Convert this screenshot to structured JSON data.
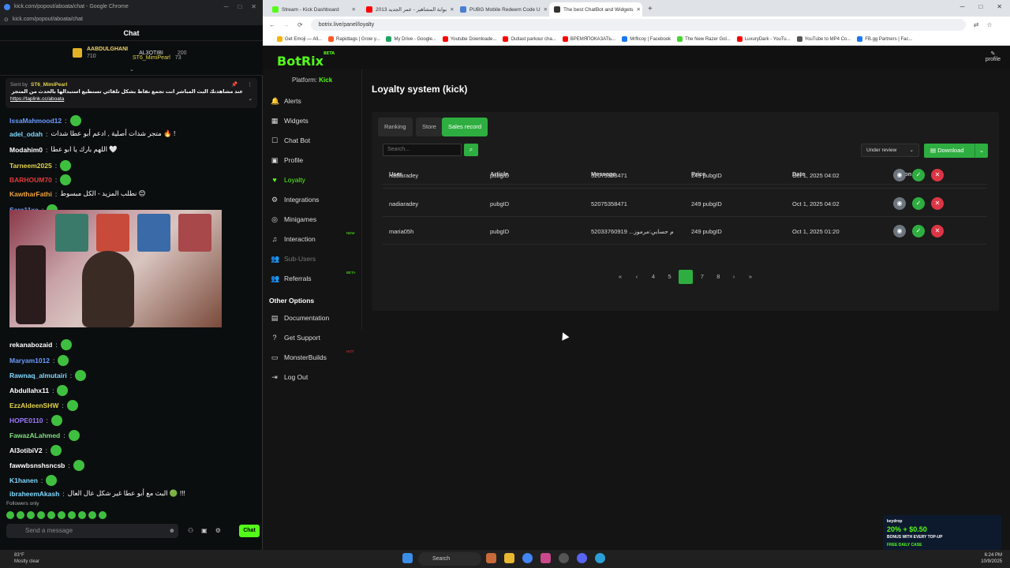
{
  "chat_window": {
    "title": "kick.com/popout/aboata/chat - Google Chrome",
    "url": "kick.com/popout/aboata/chat",
    "header": "Chat",
    "leaderboard": [
      {
        "name": "AABDULGHANI",
        "sub": "710",
        "name2": "AL3OTIBI",
        "sub2": "200"
      },
      {
        "name": "ST6_MimiPearl",
        "sub": "73"
      }
    ],
    "pinned": {
      "sender_prefix": "Sent by",
      "sender": "ST6_MimiPearl",
      "text": "عند مشاهدتك البث المباشر انت تجمع نقاط بشكل تلقائي تستطيع استبدالها بالحدث من المتجر || رابط الدعم المادي :",
      "link": "https://taplink.cc/aboata"
    },
    "messages": [
      {
        "user": "IssaMahmood12",
        "text": "",
        "color": "#6b9cff"
      },
      {
        "user": "adel_odah",
        "text": "متجر شدات أصلية , ادعم أبو عطا شدات 🔥 !",
        "color": "#7fd8ff"
      },
      {
        "user": "Modahim0",
        "text": "اللهم بارك يا ابو عطا 🤍",
        "color": "#ffffff"
      },
      {
        "user": "Tarneem2025",
        "text": "",
        "color": "#e2d34a"
      },
      {
        "user": "BARHOUM70",
        "text": "",
        "color": "#e33b3b"
      },
      {
        "user": "KawtharFathi",
        "text": "نطلب المزيد - الكل مبسوط 😊",
        "color": "#f0a23a"
      },
      {
        "user": "Sara11xa",
        "text": "",
        "color": "#6b9cff"
      },
      {
        "user": "rekanabozaid",
        "text": "",
        "color": "#ffffff"
      },
      {
        "user": "Maryam1012",
        "text": "",
        "color": "#6b9cff"
      },
      {
        "user": "Rawnaq_almutairi",
        "text": "",
        "color": "#7fd8ff"
      },
      {
        "user": "Abdullahx11",
        "text": "",
        "color": "#ffffff"
      },
      {
        "user": "EzzAldeenSHW",
        "text": "",
        "color": "#e2d34a"
      },
      {
        "user": "HOPE0110",
        "text": "",
        "color": "#9c7bff"
      },
      {
        "user": "FawazALahmed",
        "text": "",
        "color": "#7fe07f"
      },
      {
        "user": "Al3otibiV2",
        "text": "",
        "color": "#ffffff"
      },
      {
        "user": "fawwbsnshsncsb",
        "text": "",
        "color": "#ffffff"
      },
      {
        "user": "K1hanen",
        "text": "",
        "color": "#7fd8ff"
      },
      {
        "user": "ibraheemAkash",
        "text": "البث مع أبو عطا غير شكل عال العال 🟢 !!!",
        "color": "#7fd8ff"
      }
    ],
    "followers_only": "Followers only",
    "input_placeholder": "Send a message",
    "chat_button": "Chat"
  },
  "browser": {
    "tabs": [
      {
        "label": "Stream - Kick Dashboard",
        "color": "#53fc18"
      },
      {
        "label": "بوابة المشاهير - عمر الجديد 2013",
        "color": "#ff0000"
      },
      {
        "label": "PUBG Mobile Redeem Code U",
        "color": "#4a7fd1"
      },
      {
        "label": "The best ChatBot and Widgets",
        "color": "#333333"
      }
    ],
    "url": "botrix.live/panel/loyalty",
    "bookmarks": [
      {
        "label": "Get Emoji — All...",
        "color": "#f4b400"
      },
      {
        "label": "Rapidtags | Grow y...",
        "color": "#ff5722"
      },
      {
        "label": "My Drive - Google...",
        "color": "#1fa463"
      },
      {
        "label": "Youtube Downloade...",
        "color": "#ff0000"
      },
      {
        "label": "Outlast parkour cha...",
        "color": "#ff0000"
      },
      {
        "label": "ВРЕМЯПОКАЗАТЬ...",
        "color": "#ff0000"
      },
      {
        "label": "Mrflicoy | Facebook",
        "color": "#1877f2"
      },
      {
        "label": "The New Razer Gol...",
        "color": "#44d62c"
      },
      {
        "label": "LuxuryDark - YouTu...",
        "color": "#ff0000"
      },
      {
        "label": "YouTube to MP4 Co...",
        "color": "#555555"
      },
      {
        "label": "FB.gg Partners | Fac...",
        "color": "#1877f2"
      }
    ]
  },
  "site": {
    "logo": "BotRix",
    "logo_badge": "BETA",
    "profile": "profile",
    "platform_label": "Platform:",
    "platform": "Kick",
    "nav": [
      {
        "label": "Alerts",
        "icon": "bell-icon"
      },
      {
        "label": "Widgets",
        "icon": "widgets-icon"
      },
      {
        "label": "Chat Bot",
        "icon": "chatbot-icon"
      },
      {
        "label": "Profile",
        "icon": "profile-icon"
      },
      {
        "label": "Loyalty",
        "icon": "loyalty-icon"
      },
      {
        "label": "Integrations",
        "icon": "integrations-icon"
      },
      {
        "label": "Minigames",
        "icon": "minigames-icon"
      },
      {
        "label": "Interaction",
        "icon": "interaction-icon",
        "badge": "NEW"
      },
      {
        "label": "Sub-Users",
        "icon": "sub-users-icon"
      },
      {
        "label": "Referrals",
        "icon": "referrals-icon",
        "badge": "BETA"
      }
    ],
    "other_options_title": "Other Options",
    "other_nav": [
      {
        "label": "Documentation",
        "icon": "book-icon"
      },
      {
        "label": "Get Support",
        "icon": "help-icon"
      },
      {
        "label": "MonsterBuilds",
        "icon": "monitor-icon",
        "badge": "HOT"
      },
      {
        "label": "Log Out",
        "icon": "logout-icon"
      }
    ],
    "page_title": "Loyalty system (kick)",
    "tabs": [
      "Ranking",
      "Store",
      "Sales record"
    ],
    "search_placeholder": "Search...",
    "filter": "Under review",
    "download": "Download",
    "columns": [
      "User",
      "Article",
      "Message",
      "Price",
      "Date",
      "Action"
    ],
    "rows": [
      {
        "user": "nadiaradey",
        "article": "pubgID",
        "message": "52075358471",
        "price": "249 pubgID",
        "date": "Oct 1, 2025 04:02"
      },
      {
        "user": "nadiaradey",
        "article": "pubgID",
        "message": "52075358471",
        "price": "249 pubgID",
        "date": "Oct 1, 2025 04:02"
      },
      {
        "user": "maria05h",
        "article": "pubgID",
        "message": "52033760919 ...م حسابي:مرموز",
        "price": "249 pubgID",
        "date": "Oct 1, 2025 01:20"
      }
    ],
    "pagination": {
      "pages": [
        "4",
        "5",
        "6",
        "7",
        "8"
      ],
      "current": "6"
    }
  },
  "taskbar": {
    "temp": "83°F",
    "weather": "Mostly clear",
    "search": "Search",
    "time": "6:24 PM",
    "date": "10/9/2025"
  },
  "ad": {
    "brand": "keydrop",
    "headline": "20% + $0.50",
    "sub": "BONUS WITH EVERY TOP-UP",
    "cta": "FREE DAILY CASE"
  },
  "colors": {
    "kick_green": "#53fc18",
    "accent": "#2eae40",
    "danger": "#dc3545"
  }
}
